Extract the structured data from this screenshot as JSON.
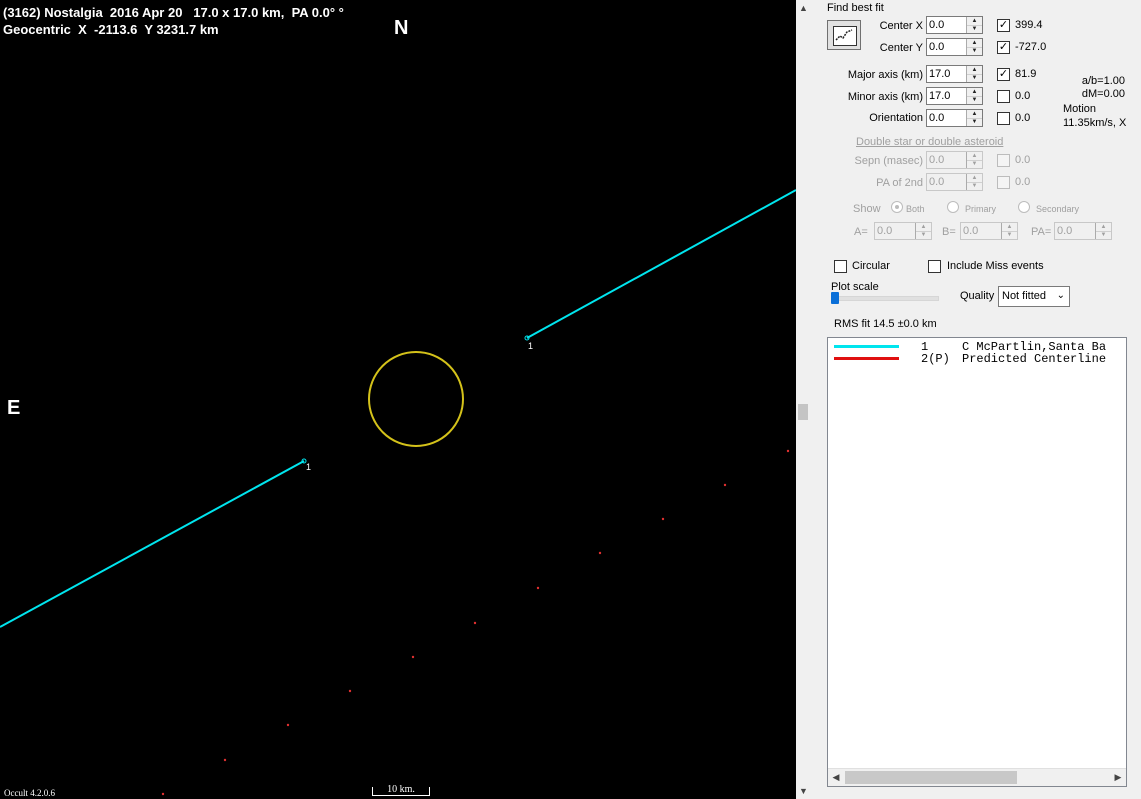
{
  "plot": {
    "header_line1": "(3162) Nostalgia  2016 Apr 20   17.0 x 17.0 km,  PA 0.0° °",
    "header_line2": "Geocentric  X  -2113.6  Y 3231.7 km",
    "north": "N",
    "east": "E",
    "chord_label_a": "1",
    "chord_label_b": "1",
    "scale_label": "10 km.",
    "version": "Occult 4.2.0.6",
    "colors": {
      "background": "#000000",
      "chord": "#00e5ee",
      "ellipse": "#d4c21a",
      "points": "#e03030",
      "text": "#ffffff"
    }
  },
  "panel": {
    "find_best_fit": "Find best fit",
    "center_x": {
      "label": "Center X",
      "value": "0.0",
      "checked": true,
      "result": "399.4"
    },
    "center_y": {
      "label": "Center Y",
      "value": "0.0",
      "checked": true,
      "result": "-727.0"
    },
    "major_axis": {
      "label": "Major axis (km)",
      "value": "17.0",
      "checked": true,
      "result": "81.9"
    },
    "minor_axis": {
      "label": "Minor axis (km)",
      "value": "17.0",
      "checked": false,
      "result": "0.0"
    },
    "orientation": {
      "label": "Orientation",
      "value": "0.0",
      "checked": false,
      "result": "0.0"
    },
    "ab_ratio": "a/b=1.00",
    "dm": "dM=0.00",
    "motion_label": "Motion",
    "motion_value": "11.35km/s, X",
    "double_star": "Double star  or  double asteroid",
    "sepn": {
      "label": "Sepn (masec)",
      "value": "0.0",
      "result": "0.0"
    },
    "pa2": {
      "label": "PA of 2nd",
      "value": "0.0",
      "result": "0.0"
    },
    "show_label": "Show",
    "show_both": "Both",
    "show_primary": "Primary",
    "show_secondary": "Secondary",
    "a_label": "A=",
    "a_value": "0.0",
    "b_label": "B=",
    "b_value": "0.0",
    "pa_label": "PA=",
    "pa_value": "0.0",
    "circular": "Circular",
    "include_miss": "Include Miss events",
    "plot_scale": "Plot scale",
    "quality_label": "Quality",
    "quality_value": "Not fitted",
    "rms_fit": "RMS fit 14.5 ±0.0 km",
    "legend": [
      {
        "num": "1",
        "text": "C McPartlin,Santa Ba",
        "color": "#00e5ee"
      },
      {
        "num": "2(P)",
        "text": "Predicted Centerline",
        "color": "#e01010"
      }
    ]
  }
}
